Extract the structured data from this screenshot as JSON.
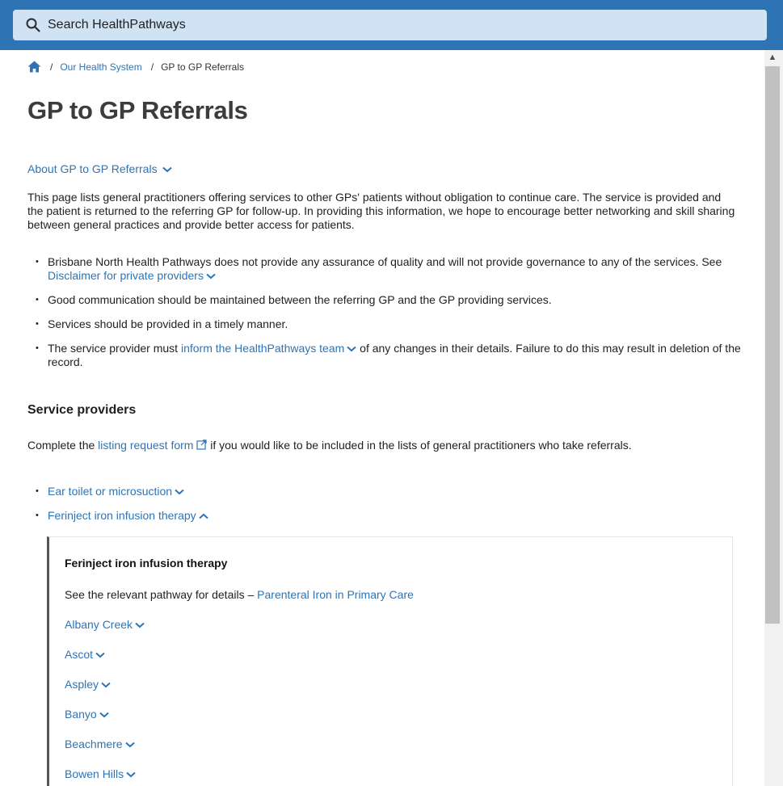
{
  "search": {
    "placeholder": "Search HealthPathways"
  },
  "breadcrumb": {
    "home_icon": "home-icon",
    "section": "Our Health System",
    "current": "GP to GP Referrals"
  },
  "page": {
    "title": "GP to GP Referrals",
    "about_label": "About GP to GP Referrals",
    "intro": "This page lists general practitioners offering services to other GPs' patients without obligation to continue care. The service is provided and the patient is returned to the referring GP for follow-up. In providing this information, we hope to encourage better networking and skill sharing between general practices and provide better access for patients.",
    "bullets": {
      "b1_text": "Brisbane North Health Pathways does not provide any assurance of quality and will not provide governance to any of the services. See",
      "b1_link": "Disclaimer for private providers",
      "b2_text": "Good communication should be maintained between the referring GP and the GP providing services.",
      "b3_text": "Services should be provided in a timely manner.",
      "b4_pre": "The service provider must",
      "b4_link": "inform the HealthPathways team",
      "b4_post": "of any changes in their details. Failure to do this may result in deletion of the record."
    },
    "service_providers": {
      "heading": "Service providers",
      "complete_pre": "Complete the",
      "complete_link": "listing request form",
      "complete_post": "if you would like to be included in the lists of general practitioners who take referrals.",
      "types": [
        "Ear toilet or microsuction",
        "Ferinject iron infusion therapy"
      ]
    },
    "panel": {
      "title": "Ferinject iron infusion therapy",
      "desc_pre": "See the relevant pathway for details –",
      "desc_link": "Parenteral Iron in Primary Care",
      "suburbs": [
        "Albany Creek",
        "Ascot",
        "Aspley",
        "Banyo",
        "Beachmere",
        "Bowen Hills"
      ]
    }
  },
  "colors": {
    "header": "#2e74b5",
    "search_bg": "#cfe3f4",
    "link": "#2e74b5"
  }
}
